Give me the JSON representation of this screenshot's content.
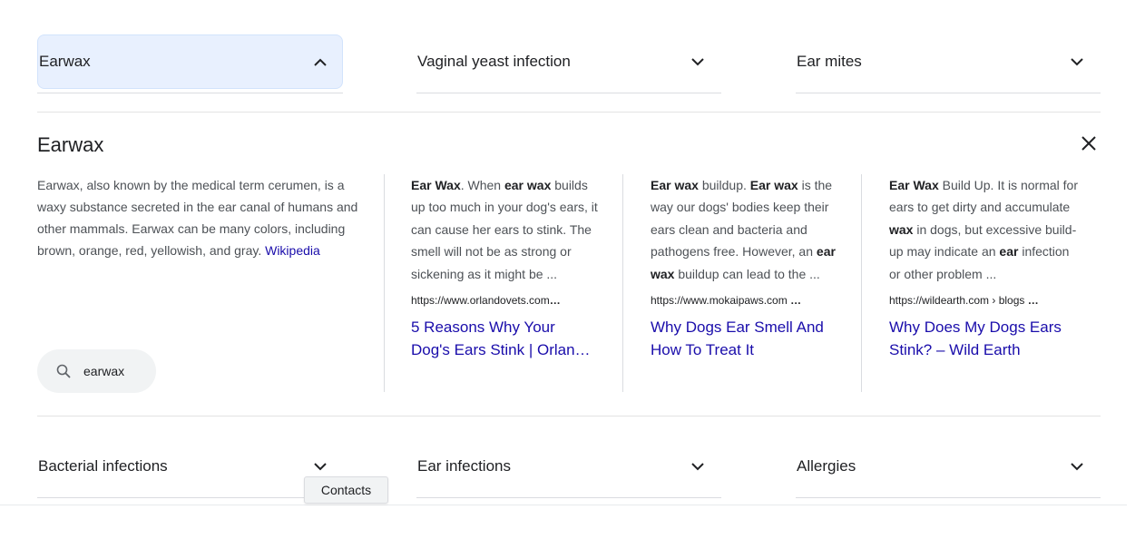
{
  "top_chips": [
    {
      "label": "Earwax",
      "expanded": true
    },
    {
      "label": "Vaginal yeast infection",
      "expanded": false
    },
    {
      "label": "Ear mites",
      "expanded": false
    }
  ],
  "panel": {
    "title": "Earwax",
    "description": "Earwax, also known by the medical term cerumen, is a waxy substance secreted in the ear canal of humans and other mammals. Earwax can be many colors, including brown, orange, red, yellowish, and gray.",
    "source_link": "Wikipedia",
    "search_query": "earwax"
  },
  "cards": [
    {
      "snippet_html": "<b>Ear Wax</b>. When <b>ear wax</b> builds up too much in your dog's ears, it can cause her ears to stink. The smell will not be as strong or sickening as it might be ...",
      "url": "https://www.orlandovets.com",
      "title": "5 Reasons Why Your Dog's Ears Stink | Orlan…"
    },
    {
      "snippet_html": "<b>Ear wax</b> buildup. <b>Ear wax</b> is the way our dogs' bodies keep their ears clean and bacteria and pathogens free. However, an <b>ear wax</b> buildup can lead to the ...",
      "url": "https://www.mokaipaws.com",
      "title": "Why Dogs Ear Smell And How To Treat It"
    },
    {
      "snippet_html": "<b>Ear Wax</b> Build Up. It is normal for ears to get dirty and accumulate <b>wax</b> in dogs, but excessive build-up may indicate an <b>ear</b> infection or other problem ...",
      "url": "https://wildearth.com › blogs",
      "title": "Why Does My Dogs Ears Stink? – Wild Earth"
    }
  ],
  "bottom_chips": [
    {
      "label": "Bacterial infections"
    },
    {
      "label": "Ear infections"
    },
    {
      "label": "Allergies"
    }
  ],
  "tooltip": "Contacts",
  "colors": {
    "link": "#1a0dab",
    "chip_active_bg": "#e8f0fe"
  }
}
